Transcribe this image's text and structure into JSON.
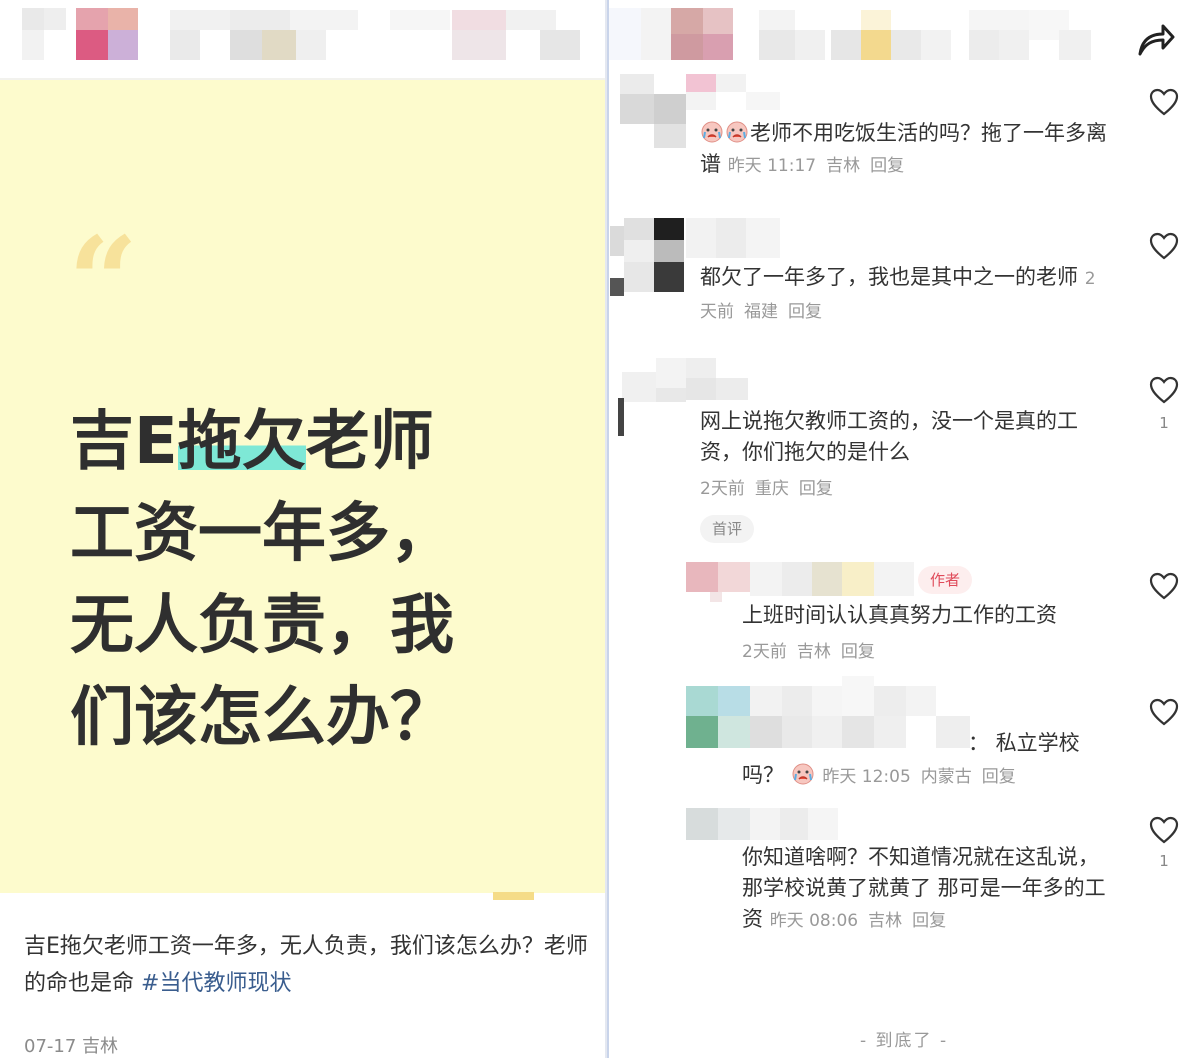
{
  "post": {
    "cover_title_pre": "吉E",
    "cover_title_hl": "拖欠",
    "cover_title_post": "老师工资一年多，无人负责，我们该怎么办？",
    "quote_mark": "“",
    "description": "吉E拖欠老师工资一年多，无人负责，我们该怎么办？老师的命也是命",
    "hashtag": "#当代教师现状",
    "date": "07-17",
    "location": "吉林"
  },
  "comments": [
    {
      "text": "老师不用吃饭生活的吗？拖了一年多离谱",
      "time": "昨天 11:17",
      "location": "吉林",
      "reply": "回复",
      "likes": ""
    },
    {
      "text": "都欠了一年多了，我也是其中之一的老师",
      "time": "2天前",
      "location": "福建",
      "reply": "回复",
      "likes": ""
    },
    {
      "text": "网上说拖欠教师工资的，没一个是真的工资，你们拖欠的是什么",
      "time": "2天前",
      "location": "重庆",
      "reply": "回复",
      "likes": "1",
      "badge": "首评"
    }
  ],
  "replies": [
    {
      "author_badge": "作者",
      "text": "上班时间认认真真努力工作的工资",
      "time": "2天前",
      "location": "吉林",
      "reply": "回复",
      "likes": ""
    },
    {
      "text_a": "：  私立学校",
      "text_b": "吗？",
      "time": "昨天 12:05",
      "location": "内蒙古",
      "reply": "回复",
      "likes": ""
    },
    {
      "text": "你知道啥啊？不知道情况就在这乱说， 那学校说黄了就黄了 那可是一年多的工资",
      "time": "昨天 08:06",
      "location": "吉林",
      "reply": "回复",
      "likes": "1"
    }
  ],
  "end_text": "- 到底了 -",
  "colors": {
    "cover_bg": "#fdfbcd",
    "highlight": "#7ee8d6",
    "hashtag": "#3a5d8e",
    "author_badge": "#e04b5a",
    "meta_gray": "#999999"
  },
  "icons": [
    "share-icon",
    "heart-icon",
    "crying-emoji-icon"
  ]
}
